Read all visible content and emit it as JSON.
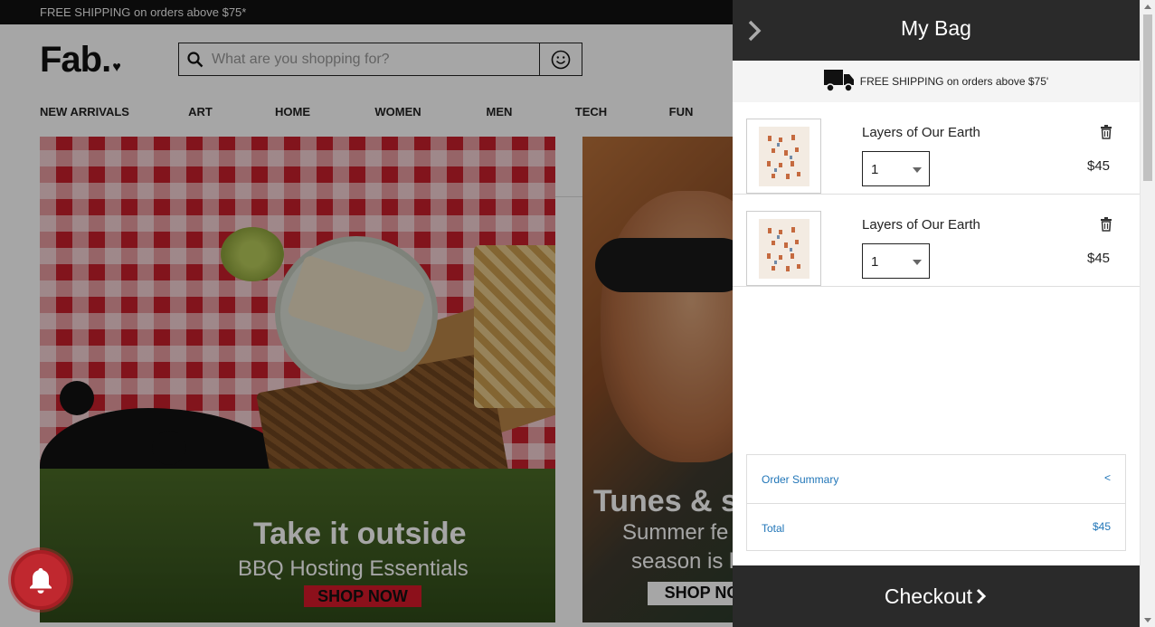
{
  "promo": {
    "text": "FREE SHIPPING on orders above $75*"
  },
  "header": {
    "logo": "Fab.",
    "search_placeholder": "What are you shopping for?"
  },
  "nav": {
    "items": [
      "NEW ARRIVALS",
      "ART",
      "HOME",
      "WOMEN",
      "MEN",
      "TECH",
      "FUN"
    ]
  },
  "banners": [
    {
      "title": "Take it outside",
      "subtitle": "BBQ Hosting Essentials",
      "cta": "SHOP NOW"
    },
    {
      "title": "Tunes & s",
      "subtitle_line1": "Summer fe",
      "subtitle_line2": "season is l",
      "cta": "SHOP NO"
    }
  ],
  "cart": {
    "title": "My Bag",
    "shipping_note": "FREE SHIPPING on orders above $75'",
    "items": [
      {
        "name": "Layers of Our Earth",
        "qty": "1",
        "price": "$45"
      },
      {
        "name": "Layers of Our Earth",
        "qty": "1",
        "price": "$45"
      }
    ],
    "summary": {
      "order_summary_label": "Order Summary",
      "order_summary_toggle": "<",
      "total_label": "Total",
      "total_value": "$45"
    },
    "checkout_label": "Checkout"
  },
  "colors": {
    "cart_header": "#2a2a2a",
    "link_blue": "#2176b8",
    "shop_now_red": "#d71a2a",
    "bell_red": "#c0282f"
  }
}
